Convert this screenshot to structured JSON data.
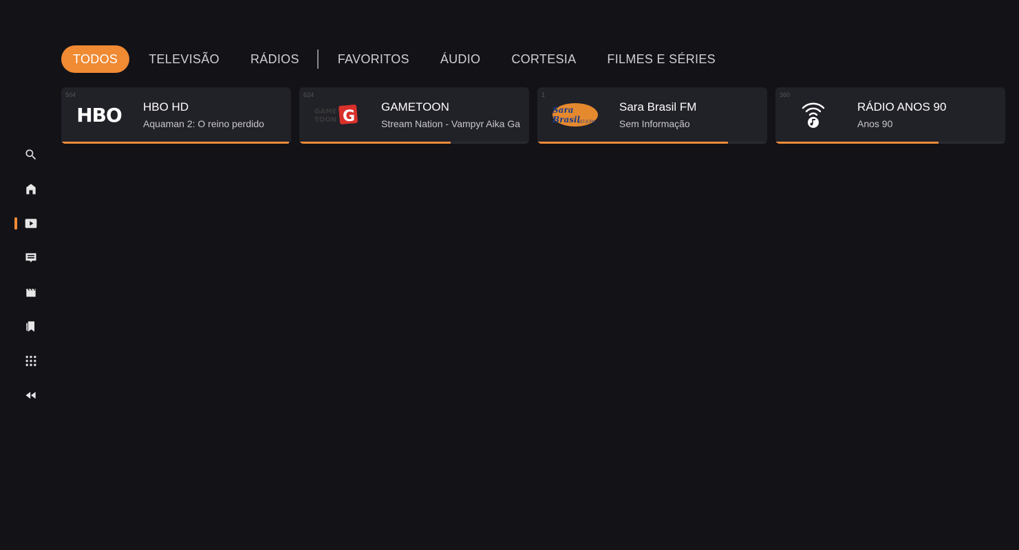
{
  "sidebar": {
    "items": [
      {
        "name": "search-icon"
      },
      {
        "name": "home-icon"
      },
      {
        "name": "live-tv-icon",
        "active": true
      },
      {
        "name": "guide-icon"
      },
      {
        "name": "movies-icon"
      },
      {
        "name": "bookmarks-icon"
      },
      {
        "name": "apps-icon"
      },
      {
        "name": "rewind-icon"
      }
    ]
  },
  "tabs": [
    {
      "label": "TODOS",
      "active": true
    },
    {
      "label": "TELEVISÃO"
    },
    {
      "label": "RÁDIOS"
    },
    {
      "label": "FAVORITOS"
    },
    {
      "label": "ÁUDIO"
    },
    {
      "label": "CORTESIA"
    },
    {
      "label": "FILMES E SÉRIES"
    }
  ],
  "cards": [
    {
      "number": "504",
      "logo": "HBO",
      "title": "HBO HD",
      "subtitle": "Aquaman 2: O reino perdido",
      "progress": 0.99
    },
    {
      "number": "624",
      "logo": "GAMETOON",
      "title": "GAMETOON",
      "subtitle": "Stream Nation - Vampyr Aika Ga",
      "progress": 0.66
    },
    {
      "number": "1",
      "logo": "Sara Brasil 107,5 FM",
      "title": "Sara Brasil FM",
      "subtitle": "Sem Informação",
      "progress": 0.83
    },
    {
      "number": "360",
      "logo": "radio-music-icon",
      "title": "RÁDIO ANOS 90",
      "subtitle": "Anos 90",
      "progress": 0.71
    }
  ],
  "colors": {
    "accent": "#f28c38",
    "background": "#121217",
    "card": "#212128"
  }
}
